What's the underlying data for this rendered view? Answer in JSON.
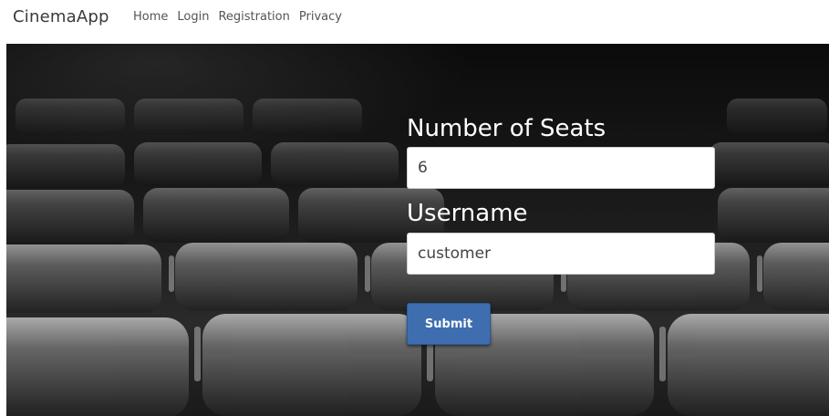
{
  "navbar": {
    "brand": "CinemaApp",
    "links": [
      "Home",
      "Login",
      "Registration",
      "Privacy"
    ]
  },
  "form": {
    "seats_label": "Number of Seats",
    "seats_value": "6",
    "username_label": "Username",
    "username_value": "customer",
    "submit_label": "Submit"
  },
  "colors": {
    "submit_bg": "#3f6eb0",
    "hero_bg": "#1b1b1b"
  }
}
